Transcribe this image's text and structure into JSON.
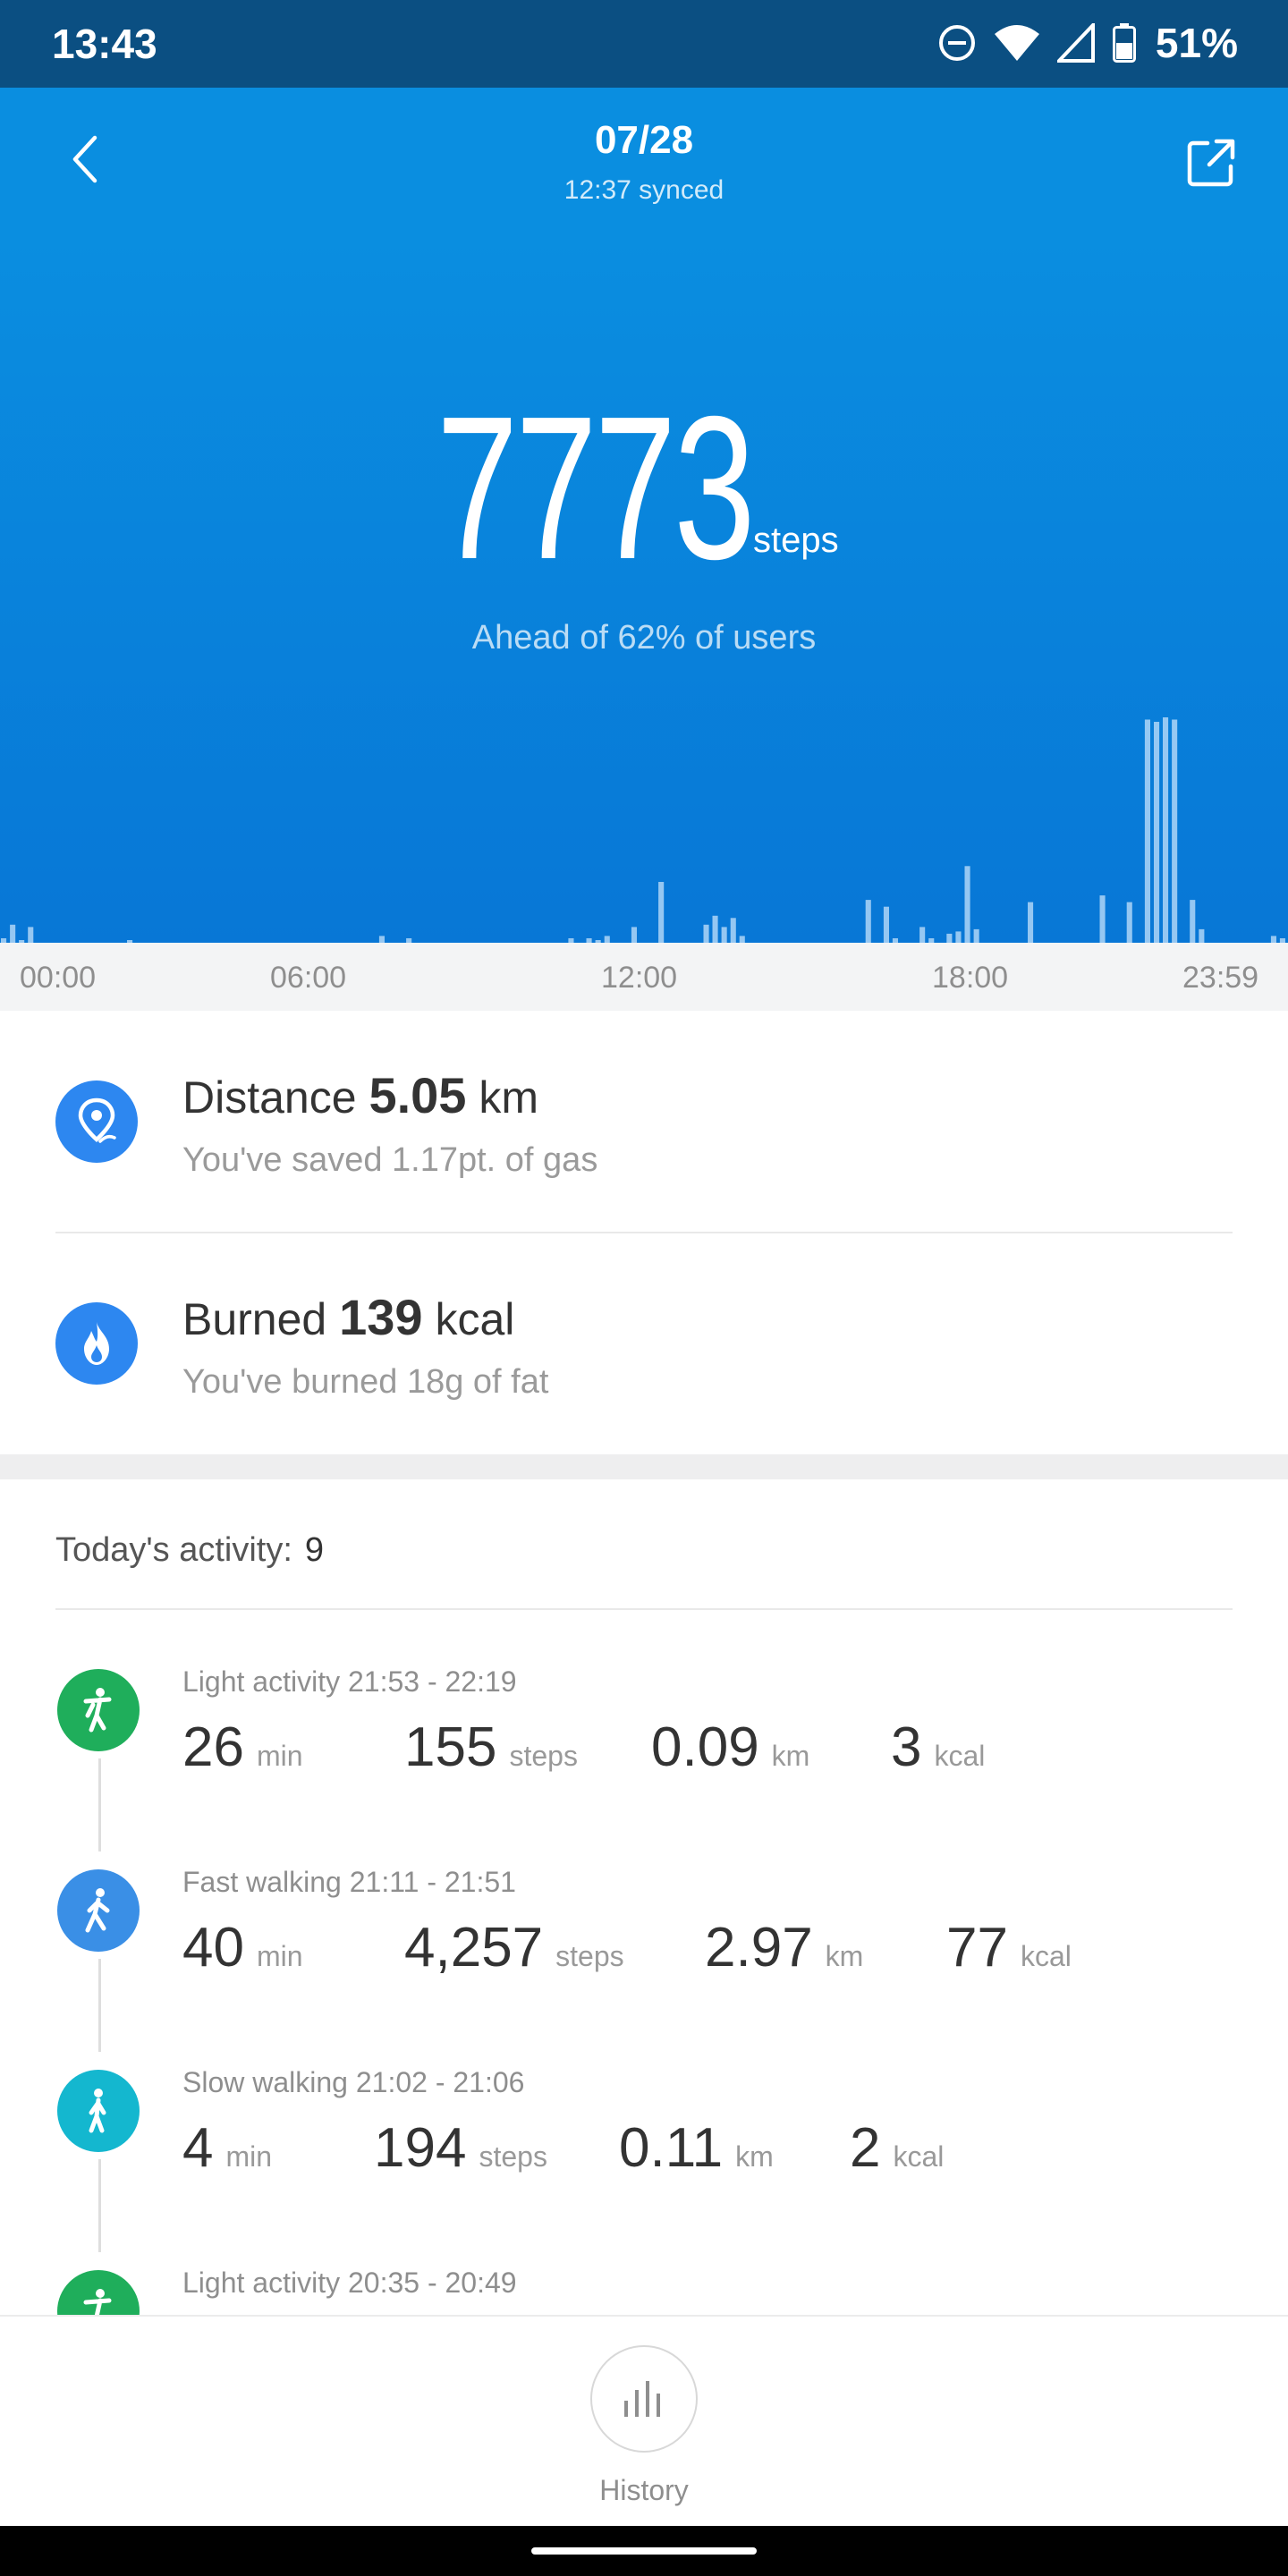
{
  "status_bar": {
    "time": "13:43",
    "battery": "51%",
    "icons": [
      "dnd-icon",
      "wifi-icon",
      "cell-signal-icon",
      "battery-icon"
    ]
  },
  "header": {
    "date": "07/28",
    "sync": "12:37 synced",
    "back_icon": "chevron-left-icon",
    "share_icon": "share-icon"
  },
  "hero": {
    "steps": "7773",
    "steps_unit": "steps",
    "rank": "Ahead of 62% of users"
  },
  "chart_data": {
    "type": "bar",
    "title": "",
    "xlabel": "",
    "ylabel": "",
    "time_labels": [
      "00:00",
      "06:00",
      "12:00",
      "18:00",
      "23:59"
    ],
    "note_units": "relative step intensity per 15-minute slot",
    "values": [
      0.02,
      0.08,
      0.01,
      0.07,
      0.0,
      0.0,
      0.0,
      0.0,
      0.0,
      0.0,
      0.0,
      0.0,
      0.0,
      0.0,
      0.01,
      0.0,
      0.0,
      0.0,
      0.0,
      0.0,
      0.0,
      0.0,
      0.0,
      0.0,
      0.0,
      0.0,
      0.0,
      0.0,
      0.0,
      0.0,
      0.0,
      0.0,
      0.0,
      0.0,
      0.0,
      0.0,
      0.0,
      0.0,
      0.0,
      0.0,
      0.0,
      0.0,
      0.03,
      0.0,
      0.0,
      0.02,
      0.0,
      0.0,
      0.0,
      0.0,
      0.0,
      0.0,
      0.0,
      0.0,
      0.0,
      0.0,
      0.0,
      0.0,
      0.0,
      0.0,
      0.0,
      0.0,
      0.0,
      0.02,
      0.0,
      0.02,
      0.01,
      0.03,
      0.0,
      0.0,
      0.07,
      0.0,
      0.0,
      0.27,
      0.0,
      0.0,
      0.0,
      0.0,
      0.08,
      0.12,
      0.07,
      0.11,
      0.03,
      0.0,
      0.0,
      0.0,
      0.0,
      0.0,
      0.0,
      0.0,
      0.0,
      0.0,
      0.0,
      0.0,
      0.0,
      0.0,
      0.19,
      0.0,
      0.16,
      0.02,
      0.0,
      0.0,
      0.07,
      0.02,
      0.0,
      0.04,
      0.05,
      0.34,
      0.06,
      0.0,
      0.0,
      0.0,
      0.0,
      0.0,
      0.18,
      0.0,
      0.0,
      0.0,
      0.0,
      0.0,
      0.0,
      0.0,
      0.21,
      0.0,
      0.0,
      0.18,
      0.0,
      0.99,
      0.98,
      1.0,
      0.99,
      0.0,
      0.19,
      0.06,
      0.0,
      0.0,
      0.0,
      0.0,
      0.0,
      0.0,
      0.0,
      0.03,
      0.02
    ]
  },
  "summary": {
    "distance": {
      "label": "Distance",
      "value": "5.05",
      "unit": "km",
      "sub": "You've saved 1.17pt. of gas",
      "icon": "location-pin-icon",
      "color": "#2d87f0"
    },
    "burned": {
      "label": "Burned",
      "value": "139",
      "unit": "kcal",
      "sub": "You've burned 18g of fat",
      "icon": "flame-icon",
      "color": "#2d87f0"
    }
  },
  "activity": {
    "label": "Today's activity:",
    "count": "9",
    "items": [
      {
        "title": "Light activity 21:53 - 22:19",
        "color": "#1fae5b",
        "icon": "light-activity-icon",
        "min": "26",
        "steps": "155",
        "km": "0.09",
        "kcal": "3"
      },
      {
        "title": "Fast walking 21:11 - 21:51",
        "color": "#3a8fe6",
        "icon": "fast-walking-icon",
        "min": "40",
        "steps": "4,257",
        "km": "2.97",
        "kcal": "77"
      },
      {
        "title": "Slow walking 21:02 - 21:06",
        "color": "#14b7cf",
        "icon": "slow-walking-icon",
        "min": "4",
        "steps": "194",
        "km": "0.11",
        "kcal": "2"
      },
      {
        "title": "Light activity 20:35 - 20:49",
        "color": "#1fae5b",
        "icon": "light-activity-icon"
      }
    ],
    "units": {
      "min": "min",
      "steps": "steps",
      "km": "km",
      "kcal": "kcal"
    }
  },
  "bottom": {
    "history_label": "History",
    "history_icon": "bar-chart-icon"
  }
}
